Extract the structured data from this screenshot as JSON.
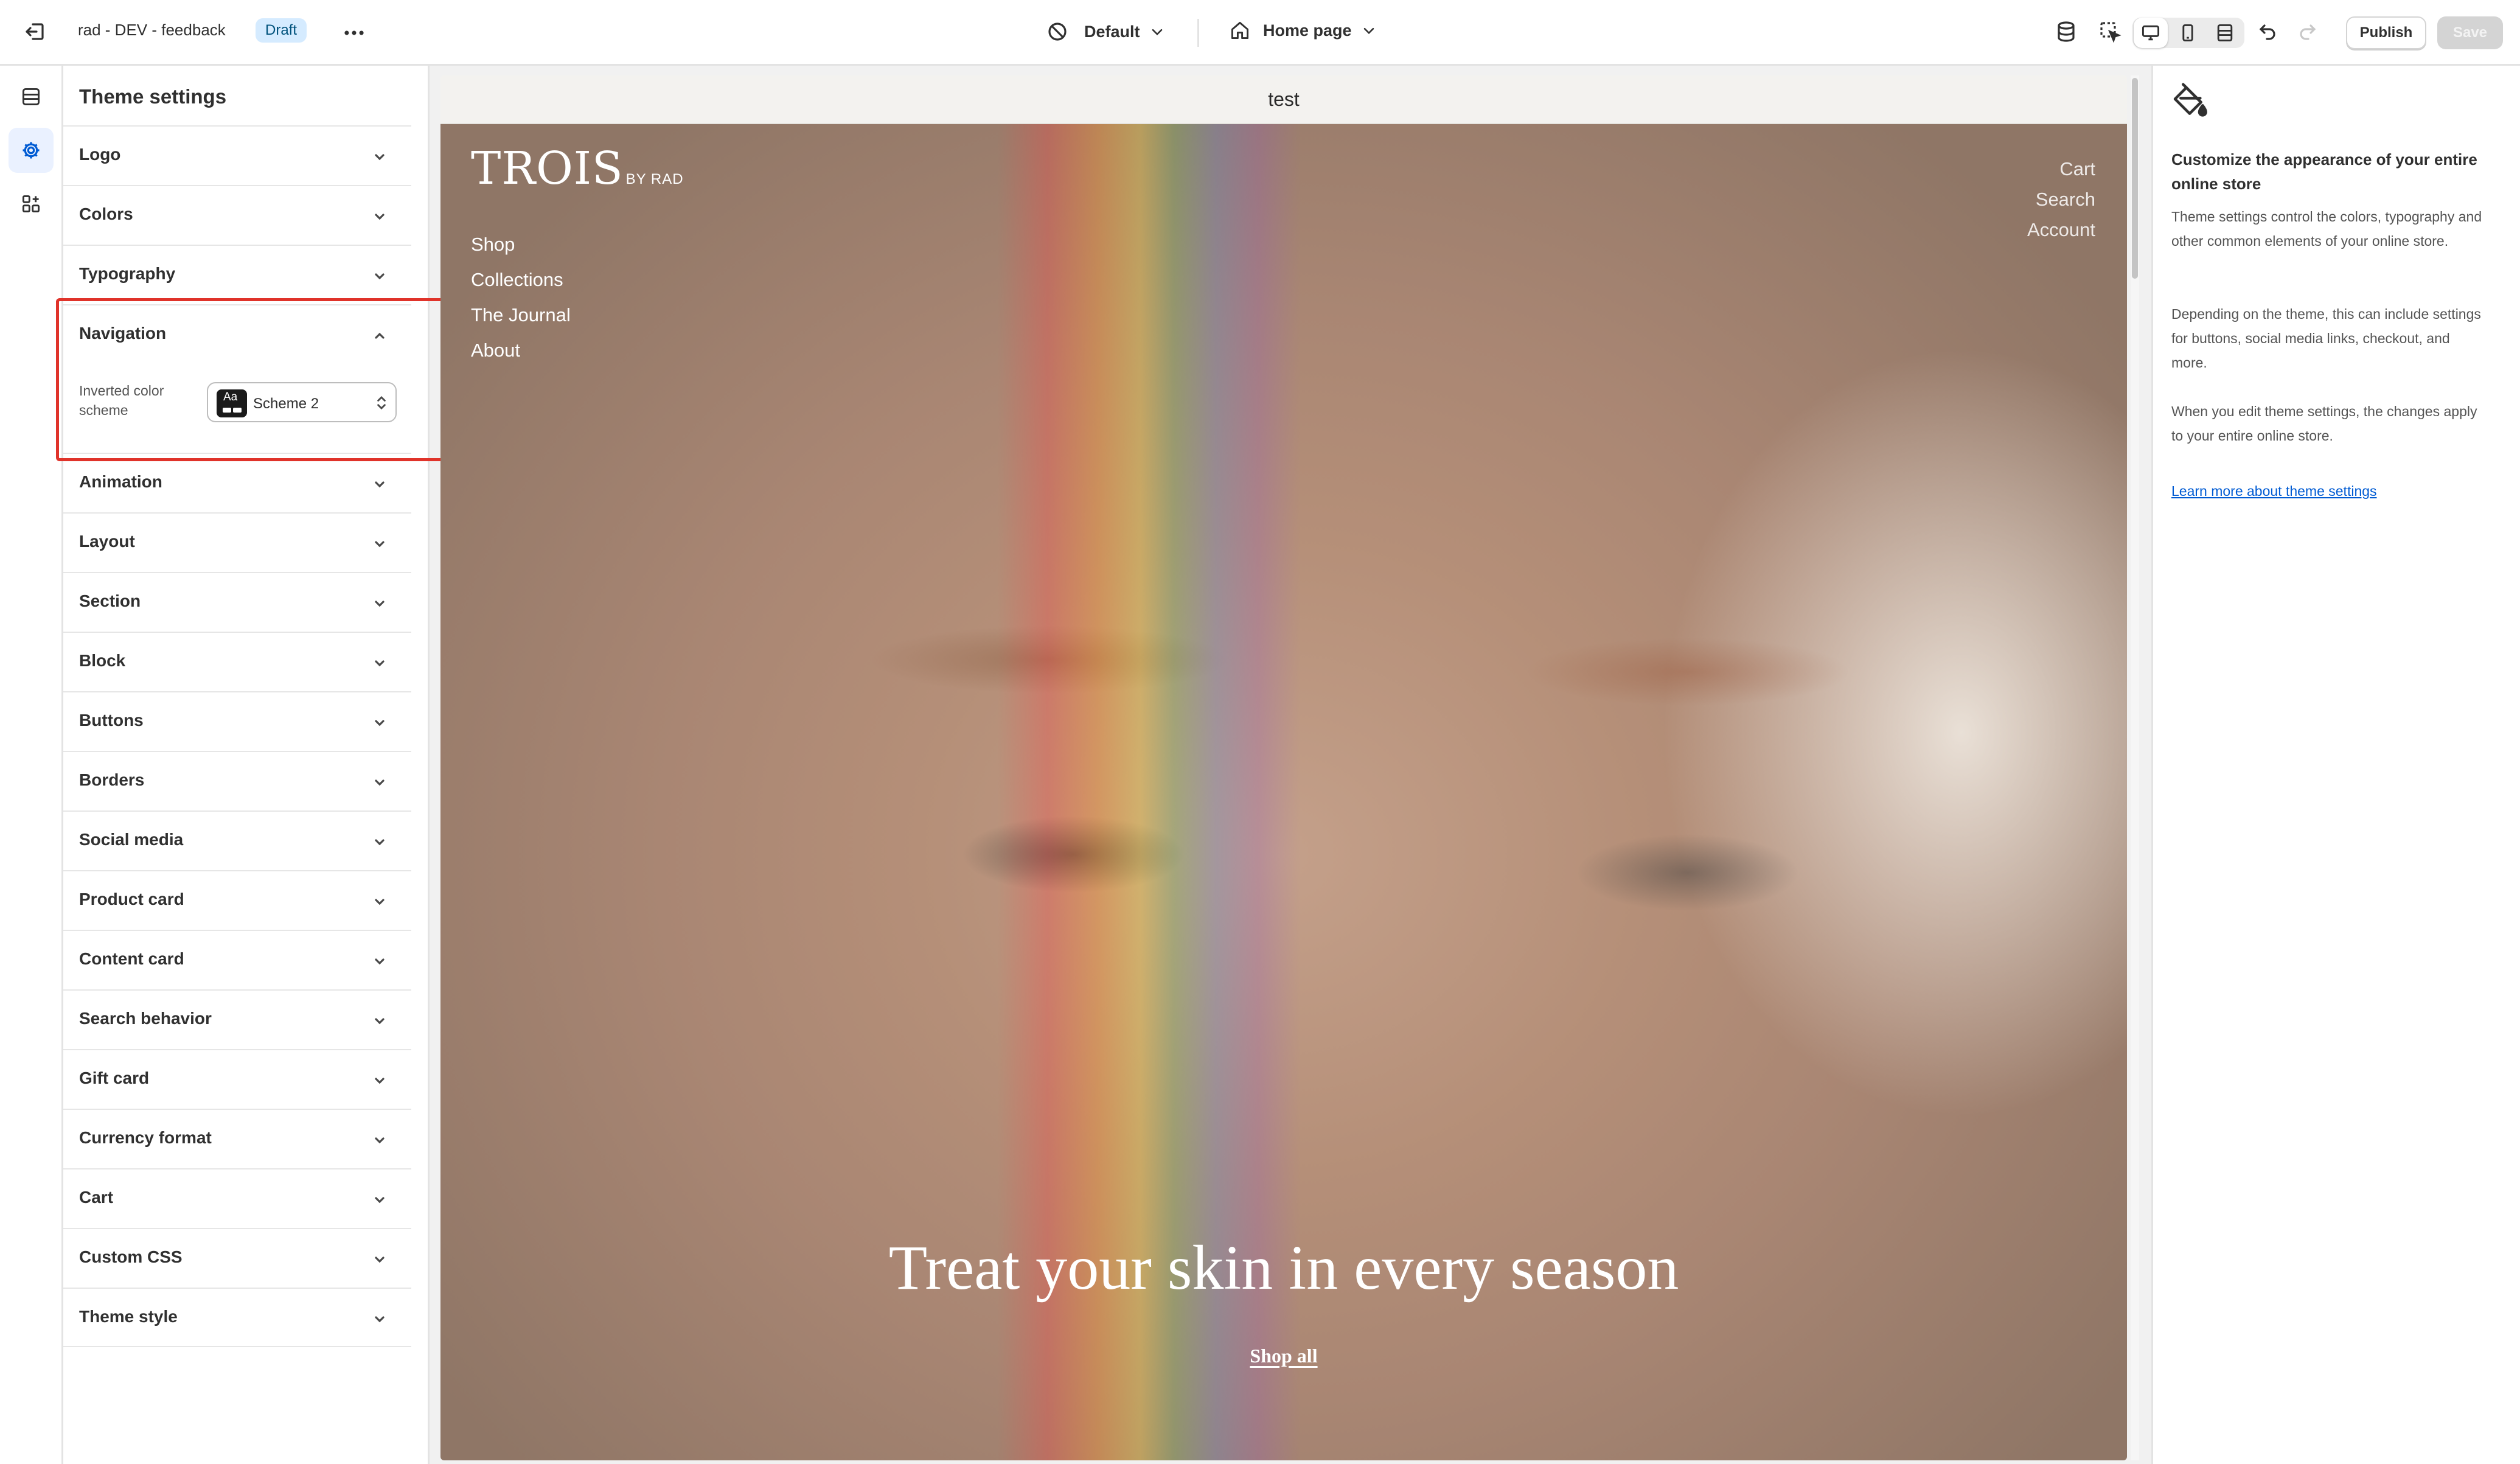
{
  "topbar": {
    "store_title": "rad - DEV - feedback",
    "status_badge": "Draft",
    "theme_dropdown": "Default",
    "page_dropdown": "Home page",
    "publish_label": "Publish",
    "save_label": "Save"
  },
  "panel": {
    "title": "Theme settings",
    "sections": [
      {
        "label": "Logo"
      },
      {
        "label": "Colors"
      },
      {
        "label": "Typography"
      },
      {
        "label": "Navigation",
        "expanded": true
      },
      {
        "label": "Animation"
      },
      {
        "label": "Layout"
      },
      {
        "label": "Section"
      },
      {
        "label": "Block"
      },
      {
        "label": "Buttons"
      },
      {
        "label": "Borders"
      },
      {
        "label": "Social media"
      },
      {
        "label": "Product card"
      },
      {
        "label": "Content card"
      },
      {
        "label": "Search behavior"
      },
      {
        "label": "Gift card"
      },
      {
        "label": "Currency format"
      },
      {
        "label": "Cart"
      },
      {
        "label": "Custom CSS"
      },
      {
        "label": "Theme style"
      }
    ],
    "navigation": {
      "field_label": "Inverted color scheme",
      "swatch_text": "Aa",
      "selected_value": "Scheme 2"
    }
  },
  "preview": {
    "announcement": "test",
    "logo_main": "TROIS",
    "logo_sub": "BY RAD",
    "menu": [
      "Shop",
      "Collections",
      "The Journal",
      "About"
    ],
    "utility": [
      "Cart",
      "Search",
      "Account"
    ],
    "hero_heading": "Treat your skin in every season",
    "hero_button": "Shop all"
  },
  "info": {
    "heading": "Customize the appearance of your entire online store",
    "paragraphs": [
      "Theme settings control the colors, typography and other common elements of your online store.",
      "Depending on the theme, this can include settings for buttons, social media links, checkout, and more.",
      "When you edit theme settings, the changes apply to your entire online store."
    ],
    "link": "Learn more about theme settings"
  },
  "icons": {
    "exit": "exit-icon",
    "more": "more-horizontal-icon",
    "theme": "theme-style-icon",
    "home": "home-icon",
    "sections": "sections-icon",
    "settings": "gear-icon",
    "apps": "apps-icon",
    "paint": "paint-bucket-icon"
  },
  "colors": {
    "accent": "#005bd3",
    "highlight_border": "#e0332a",
    "badge_bg": "#d5ebff"
  }
}
